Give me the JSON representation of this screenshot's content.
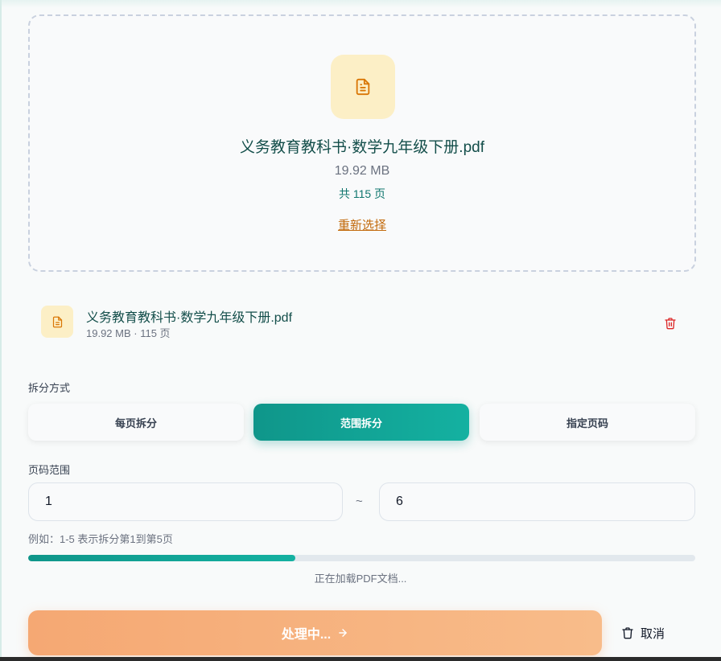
{
  "dropzone": {
    "file_name": "义务教育教科书·数学九年级下册.pdf",
    "file_size": "19.92 MB",
    "page_count": "共 115 页",
    "reselect_label": "重新选择"
  },
  "file_item": {
    "name": "义务教育教科书·数学九年级下册.pdf",
    "meta": "19.92 MB · 115 页"
  },
  "split_mode": {
    "label": "拆分方式",
    "options": [
      "每页拆分",
      "范围拆分",
      "指定页码"
    ],
    "selected": "范围拆分"
  },
  "page_range": {
    "label": "页码范围",
    "from": "1",
    "separator": "~",
    "to": "6",
    "hint": "例如：1-5 表示拆分第1到第5页"
  },
  "progress": {
    "fraction": 0.4,
    "text": "正在加载PDF文档..."
  },
  "actions": {
    "process_label": "处理中...",
    "cancel_label": "取消"
  },
  "colors": {
    "accent": "#0f968a",
    "file_icon": "#d97706",
    "delete_icon": "#dc2626",
    "process_button": "#f5a873"
  },
  "icons": {
    "file": "file-text-icon",
    "delete": "trash-icon",
    "arrow": "arrow-right-icon",
    "cancel": "trash-icon"
  }
}
